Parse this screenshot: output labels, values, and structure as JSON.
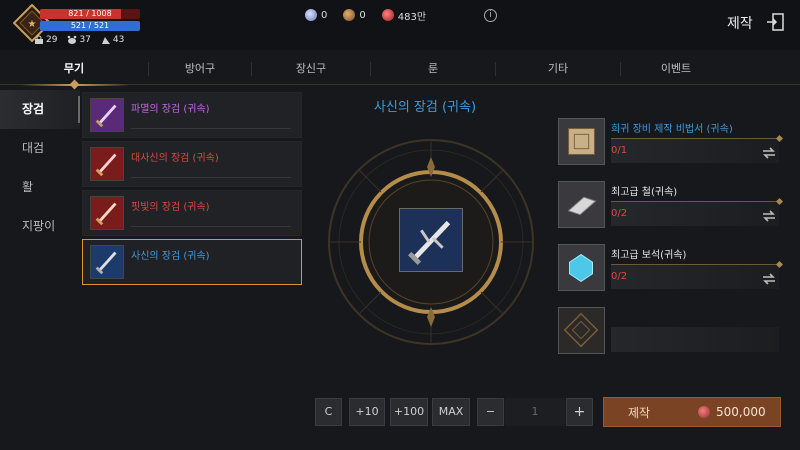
{
  "player": {
    "hp": "821 / 1008",
    "hp_fraction": 0.81,
    "mp": "521 / 521",
    "mp_fraction": 1.0,
    "stats": [
      {
        "icon": "weight-icon",
        "value": "29"
      },
      {
        "icon": "pet-icon",
        "value": "37"
      },
      {
        "icon": "mount-icon",
        "value": "43"
      }
    ]
  },
  "currency": [
    {
      "icon": "crystal-icon",
      "value": "0",
      "color": "#9aa8d8"
    },
    {
      "icon": "coin-icon",
      "value": "0",
      "color": "#a0703a"
    },
    {
      "icon": "ruby-icon",
      "value": "483만",
      "color": "#d24040"
    }
  ],
  "header": {
    "title": "제작",
    "info_icon": "info-icon",
    "exit_icon": "exit-icon"
  },
  "tabs": [
    {
      "label": "무기",
      "active": true
    },
    {
      "label": "방어구",
      "active": false
    },
    {
      "label": "장신구",
      "active": false
    },
    {
      "label": "룬",
      "active": false
    },
    {
      "label": "기타",
      "active": false
    },
    {
      "label": "이벤트",
      "active": false
    }
  ],
  "categories": [
    {
      "label": "장검",
      "active": true
    },
    {
      "label": "대검",
      "active": false
    },
    {
      "label": "활",
      "active": false
    },
    {
      "label": "지팡이",
      "active": false
    }
  ],
  "recipes": [
    {
      "label": "파멸의 장검 (귀속)",
      "color": "#c06ae0",
      "bg": "#5a2a78",
      "selected": false
    },
    {
      "label": "대사신의 장검 (귀속)",
      "color": "#e0493f",
      "bg": "#7a1c1c",
      "selected": false
    },
    {
      "label": "핏빛의 장검 (귀속)",
      "color": "#e0493f",
      "bg": "#7a1c1c",
      "selected": false
    },
    {
      "label": "사신의 장검 (귀속)",
      "color": "#3e9be0",
      "bg": "#1c3a6a",
      "selected": true
    }
  ],
  "selected_item": {
    "title": "사신의 장검 (귀속)"
  },
  "materials": [
    {
      "name": "희귀 장비 제작 비법서 (귀속)",
      "count": "0/1",
      "name_color": "#3e9be0",
      "icon": "recipe-book-icon"
    },
    {
      "name": "최고급 철(귀속)",
      "count": "0/2",
      "name_color": "#e6e6e6",
      "icon": "iron-ingot-icon"
    },
    {
      "name": "최고급 보석(귀속)",
      "count": "0/2",
      "name_color": "#e6e6e6",
      "icon": "gem-icon"
    }
  ],
  "controls": {
    "clear": "C",
    "plus10": "+10",
    "plus100": "+100",
    "max": "MAX",
    "minus": "−",
    "quantity": "1",
    "plus": "+",
    "craft": "제작",
    "cost": "500,000"
  },
  "colors": {
    "accent": "#c8a05a",
    "craft_button": "#7a4424",
    "rare_blue": "#3e9be0",
    "missing_red": "#e0493f"
  }
}
